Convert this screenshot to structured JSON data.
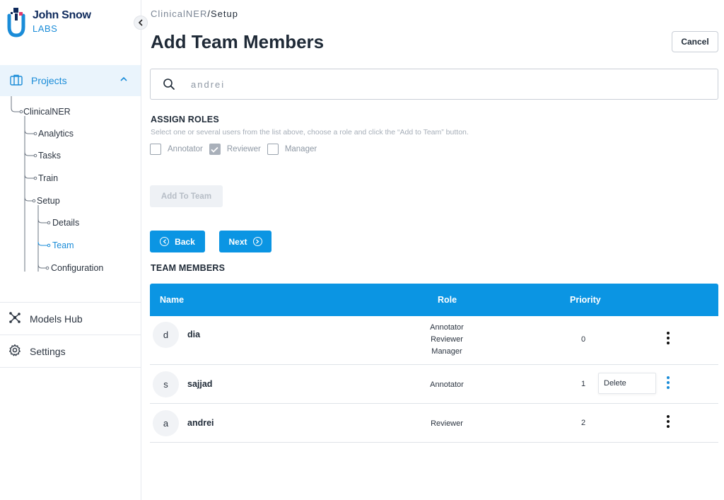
{
  "brand": {
    "name_line1": "John Snow",
    "name_line2": "LABS"
  },
  "sidebar": {
    "projects_label": "Projects",
    "tree": {
      "project": "ClinicalNER",
      "analytics": "Analytics",
      "tasks": "Tasks",
      "train": "Train",
      "setup": "Setup",
      "details": "Details",
      "team": "Team",
      "configuration": "Configuration"
    },
    "models_hub_label": "Models Hub",
    "settings_label": "Settings"
  },
  "breadcrumb": {
    "project": "ClinicalNER",
    "separator": "/",
    "current": "Setup"
  },
  "page": {
    "title": "Add Team Members",
    "cancel_label": "Cancel"
  },
  "search": {
    "value": "andrei",
    "placeholder": ""
  },
  "assign": {
    "title": "ASSIGN ROLES",
    "hint": "Select one or several users from the list above, choose a role and click the “Add to Team” button.",
    "roles": [
      {
        "label": "Annotator",
        "checked": false
      },
      {
        "label": "Reviewer",
        "checked": true
      },
      {
        "label": "Manager",
        "checked": false
      }
    ],
    "add_button": "Add To Team"
  },
  "nav_buttons": {
    "back": "Back",
    "next": "Next"
  },
  "team": {
    "title": "TEAM MEMBERS",
    "columns": {
      "name": "Name",
      "role": "Role",
      "priority": "Priority"
    },
    "rows": [
      {
        "initial": "d",
        "name": "dia",
        "roles": [
          "Annotator",
          "Reviewer",
          "Manager"
        ],
        "priority": "0"
      },
      {
        "initial": "s",
        "name": "sajjad",
        "roles": [
          "Annotator"
        ],
        "priority": "1",
        "menu_open": true,
        "menu_item": "Delete"
      },
      {
        "initial": "a",
        "name": "andrei",
        "roles": [
          "Reviewer"
        ],
        "priority": "2"
      }
    ]
  },
  "colors": {
    "accent": "#0b95e3",
    "brand_navy": "#0e2a5c",
    "sidebar_active_bg": "#eaf4fc"
  }
}
